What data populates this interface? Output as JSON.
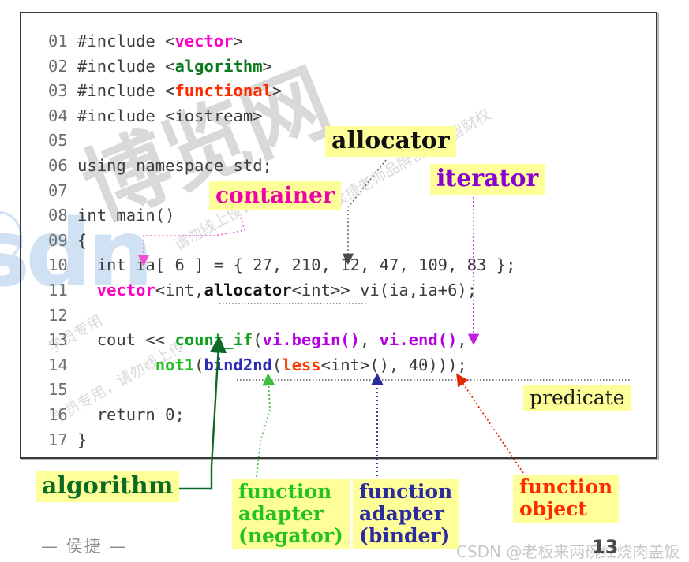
{
  "slide": {
    "page_number": "13",
    "author_footer": "— 侯捷 —",
    "csdn_watermark": "CSDN @老板来两碗红烧肉盖饭",
    "watermark_blue": "sdn",
    "watermark_gray_big": "博览网",
    "watermark_gray_lines": [
      "学员专用，请勿线上传",
      "请勿线上侵害",
      "侯捷老师品牌创意与智财权",
      "学员专用"
    ]
  },
  "code": {
    "lines": [
      {
        "no": "01",
        "segments": [
          {
            "t": "#include <",
            "c": "plain"
          },
          {
            "t": "vector",
            "c": "k-vector"
          },
          {
            "t": ">",
            "c": "plain"
          }
        ]
      },
      {
        "no": "02",
        "segments": [
          {
            "t": "#include <",
            "c": "plain"
          },
          {
            "t": "algorithm",
            "c": "k-algorithm"
          },
          {
            "t": ">",
            "c": "plain"
          }
        ]
      },
      {
        "no": "03",
        "segments": [
          {
            "t": "#include <",
            "c": "plain"
          },
          {
            "t": "functional",
            "c": "k-functional"
          },
          {
            "t": ">",
            "c": "plain"
          }
        ]
      },
      {
        "no": "04",
        "segments": [
          {
            "t": "#include <iostream>",
            "c": "plain"
          }
        ]
      },
      {
        "no": "05",
        "segments": [
          {
            "t": "",
            "c": "plain"
          }
        ]
      },
      {
        "no": "06",
        "segments": [
          {
            "t": "using namespace std;",
            "c": "plain"
          }
        ]
      },
      {
        "no": "07",
        "segments": [
          {
            "t": "",
            "c": "plain"
          }
        ]
      },
      {
        "no": "08",
        "segments": [
          {
            "t": "int main()",
            "c": "plain"
          }
        ]
      },
      {
        "no": "09",
        "segments": [
          {
            "t": "{",
            "c": "plain"
          }
        ]
      },
      {
        "no": "10",
        "segments": [
          {
            "t": "  int ia[ 6 ] = { 27, 210, 12, 47, 109, 83 };",
            "c": "plain"
          }
        ]
      },
      {
        "no": "11",
        "segments": [
          {
            "t": "  ",
            "c": "plain"
          },
          {
            "t": "vector",
            "c": "k-vector"
          },
          {
            "t": "<int,",
            "c": "plain"
          },
          {
            "t": "allocator",
            "c": "k-alloc"
          },
          {
            "t": "<int>> vi(ia,ia+6);",
            "c": "plain"
          }
        ]
      },
      {
        "no": "12",
        "segments": [
          {
            "t": "",
            "c": "plain"
          }
        ]
      },
      {
        "no": "13",
        "segments": [
          {
            "t": "  cout << ",
            "c": "plain"
          },
          {
            "t": "count_if",
            "c": "k-countif"
          },
          {
            "t": "(",
            "c": "plain"
          },
          {
            "t": "vi.begin()",
            "c": "k-viter"
          },
          {
            "t": ", ",
            "c": "plain"
          },
          {
            "t": "vi.end()",
            "c": "k-viter"
          },
          {
            "t": ",",
            "c": "plain"
          }
        ]
      },
      {
        "no": "14",
        "segments": [
          {
            "t": "        ",
            "c": "plain"
          },
          {
            "t": "not1",
            "c": "k-not1"
          },
          {
            "t": "(",
            "c": "plain"
          },
          {
            "t": "bind2nd",
            "c": "k-bind2nd"
          },
          {
            "t": "(",
            "c": "plain"
          },
          {
            "t": "less",
            "c": "k-less"
          },
          {
            "t": "<int>(), 40)));",
            "c": "plain"
          }
        ]
      },
      {
        "no": "15",
        "segments": [
          {
            "t": "",
            "c": "plain"
          }
        ]
      },
      {
        "no": "16",
        "segments": [
          {
            "t": "  return 0;",
            "c": "plain"
          }
        ]
      },
      {
        "no": "17",
        "segments": [
          {
            "t": "}",
            "c": "plain"
          }
        ]
      }
    ]
  },
  "annotations": {
    "allocator": {
      "label": "allocator",
      "color": "#111111"
    },
    "iterator": {
      "label": "iterator",
      "color": "#8a00d4"
    },
    "container": {
      "label": "container",
      "color": "#ee00aa"
    },
    "predicate": {
      "label": "predicate",
      "color": "#1a1a1a"
    },
    "algorithm": {
      "label": "algorithm",
      "color": "#0b6b26"
    },
    "negator": {
      "label": "function\nadapter\n(negator)",
      "color": "#21c221"
    },
    "binder": {
      "label": "function\nadapter\n(binder)",
      "color": "#2b2b9e"
    },
    "function_object": {
      "label": "function\nobject",
      "color": "#ff2b00"
    }
  }
}
